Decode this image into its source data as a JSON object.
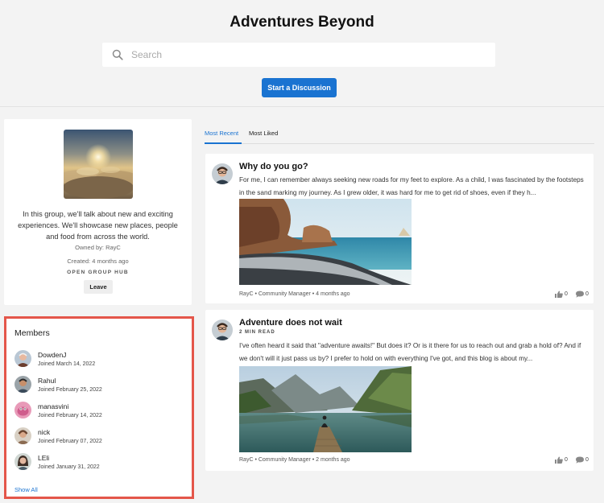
{
  "header": {
    "title": "Adventures Beyond",
    "search_placeholder": "Search",
    "start_button": "Start a Discussion"
  },
  "about": {
    "description": "In this group, we'll talk about new and exciting experiences. We'll showcase new places, people and food from across the world.",
    "owned_by": "Owned by: RayC",
    "created": "Created: 4 months ago",
    "hub_type": "OPEN GROUP HUB",
    "leave_button": "Leave"
  },
  "members": {
    "title": "Members",
    "items": [
      {
        "name": "DowdenJ",
        "joined": "Joined March 14, 2022"
      },
      {
        "name": "Rahul",
        "joined": "Joined February 25, 2022"
      },
      {
        "name": "manasvini",
        "joined": "Joined February 14, 2022"
      },
      {
        "name": "nick",
        "joined": "Joined February 07, 2022"
      },
      {
        "name": "LEli",
        "joined": "Joined January 31, 2022"
      }
    ],
    "show_all": "Show All"
  },
  "tabs": [
    {
      "label": "Most Recent",
      "active": true
    },
    {
      "label": "Most Liked",
      "active": false
    }
  ],
  "posts": [
    {
      "title": "Why do you go?",
      "read_time": "",
      "excerpt": "For me, I can remember always seeking new roads for my feet to explore. As a child, I was fascinated by the footsteps in the sand marking my journey. As I grew older, it was hard for me to get rid of shoes, even if they h...",
      "meta": "RayC • Community Manager • 4 months ago",
      "likes": "0",
      "comments": "0"
    },
    {
      "title": "Adventure does not wait",
      "read_time": "2 MIN READ",
      "excerpt": "I've often heard it said that \"adventure awaits!\" But does it? Or is it there for us to reach out and grab a hold of? And if we don't will it just pass us by? I prefer to hold on with everything I've got, and this blog is about my...",
      "meta": "RayC • Community Manager • 2 months ago",
      "likes": "0",
      "comments": "0"
    }
  ],
  "colors": {
    "accent": "#1a73d1",
    "highlight_border": "#e4564a",
    "background": "#f3f3f3"
  },
  "icons": [
    "search-icon",
    "thumbs-up-icon",
    "comment-icon"
  ]
}
